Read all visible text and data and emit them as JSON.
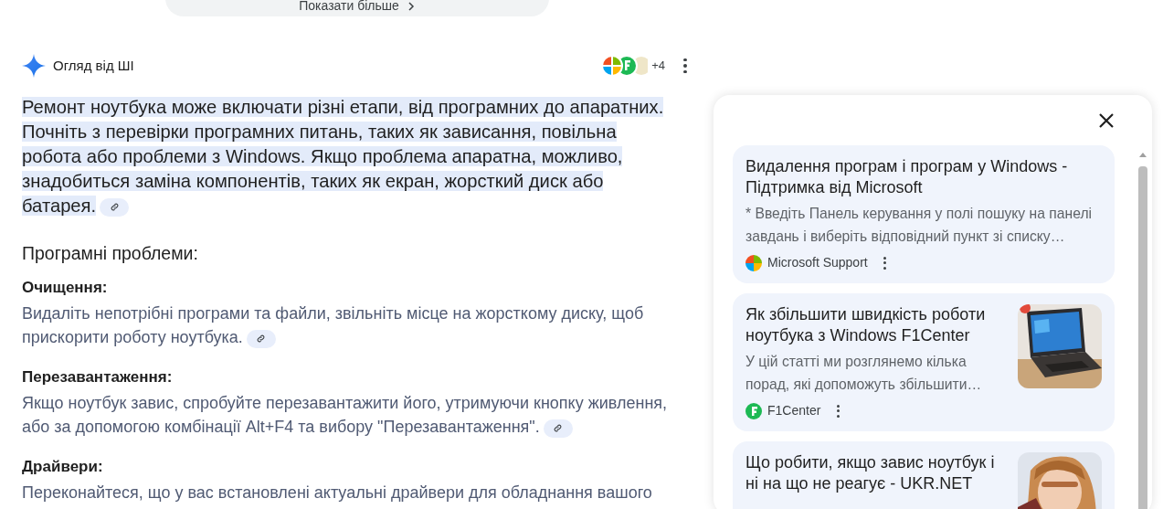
{
  "show_more_button": {
    "label": "Показати більше"
  },
  "overview": {
    "title": "Огляд від ШІ",
    "sources_more": "+4",
    "intro": {
      "text": "Ремонт ноутбука може включати різні етапи, від програмних до апаратних.  Почніть з перевірки програмних питань, таких як зависання, повільна робота або проблеми з Windows.  Якщо проблема апаратна, можливо, знадобиться заміна компонентів, таких як екран, жорсткий диск або батарея."
    },
    "section_title": "Програмні проблеми:",
    "items": [
      {
        "title": "Очищення:",
        "text": "Видаліть непотрібні програми та файли, звільніть місце на жорсткому диску, щоб прискорити роботу ноутбука."
      },
      {
        "title": "Перезавантаження:",
        "text": "Якщо ноутбук завис, спробуйте перезавантажити його, утримуючи кнопку живлення, або за допомогою комбінації Alt+F4 та вибору \"Перезавантаження\"."
      },
      {
        "title": "Драйвери:",
        "text": "Переконайтеся, що у вас встановлені актуальні драйвери для обладнання вашого"
      }
    ]
  },
  "sources_panel": {
    "cards": [
      {
        "title": "Видалення програм і програм у Windows - Підтримка від Microsoft",
        "snippet": "* Введіть Панель керування у полі пошуку на панелі завдань і виберіть відповідний пункт зі списку…",
        "source": "Microsoft Support"
      },
      {
        "title": "Як збільшити швидкість роботи ноутбука з Windows F1Center",
        "snippet": "У цій статті ми розглянемо кілька порад, які допоможуть збільшити…",
        "source": "F1Center"
      },
      {
        "title": "Що робити, якщо завис ноутбук і ні на що не реагує - UKR.NET"
      }
    ]
  }
}
